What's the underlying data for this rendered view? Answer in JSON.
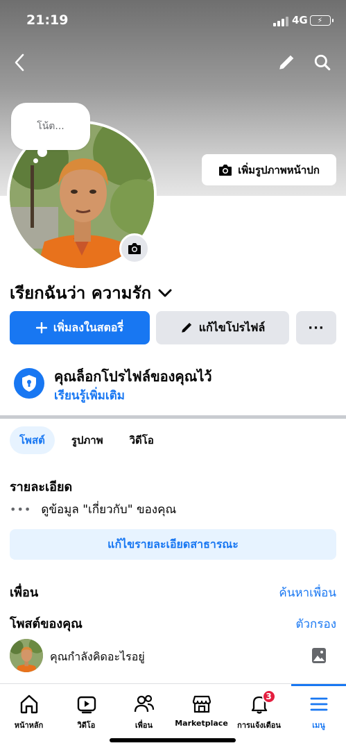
{
  "status_bar": {
    "time": "21:19",
    "network": "4G"
  },
  "header": {
    "icons": [
      "chevron-left-icon",
      "pencil-icon",
      "search-icon"
    ]
  },
  "note": {
    "placeholder": "โน้ต..."
  },
  "cover": {
    "add_cover_label": "เพิ่มรูปภาพหน้าปก"
  },
  "profile": {
    "name": "เรียกฉันว่า ความรัก"
  },
  "actions": {
    "add_story": "เพิ่มลงในสตอรี่",
    "edit_profile": "แก้ไขโปรไฟล์",
    "more": "···"
  },
  "lock_notice": {
    "title": "คุณล็อกโปรไฟล์ของคุณไว้",
    "link": "เรียนรู้เพิ่มเติม"
  },
  "tabs": [
    {
      "label": "โพสต์",
      "active": true
    },
    {
      "label": "รูปภาพ",
      "active": false
    },
    {
      "label": "วิดีโอ",
      "active": false
    }
  ],
  "details": {
    "heading": "รายละเอียด",
    "about_row": "ดูข้อมูล \"เกี่ยวกับ\" ของคุณ",
    "edit_public": "แก้ไขรายละเอียดสาธารณะ"
  },
  "friends": {
    "heading": "เพื่อน",
    "link": "ค้นหาเพื่อน"
  },
  "posts": {
    "heading": "โพสต์ของคุณ",
    "link": "ตัวกรอง",
    "composer_prompt": "คุณกำลังคิดอะไรอยู่"
  },
  "bottom_nav": [
    {
      "label": "หน้าหลัก",
      "icon": "home-icon",
      "active": false
    },
    {
      "label": "วิดีโอ",
      "icon": "video-icon",
      "active": false
    },
    {
      "label": "เพื่อน",
      "icon": "friends-icon",
      "active": false
    },
    {
      "label": "Marketplace",
      "icon": "marketplace-icon",
      "active": false
    },
    {
      "label": "การแจ้งเตือน",
      "icon": "bell-icon",
      "active": false,
      "badge": "3"
    },
    {
      "label": "เมนู",
      "icon": "menu-icon",
      "active": true
    }
  ],
  "colors": {
    "accent": "#1877f2",
    "badge": "#e41e3f",
    "soft_blue": "#e7f3ff",
    "button_gray": "#e4e6eb"
  }
}
